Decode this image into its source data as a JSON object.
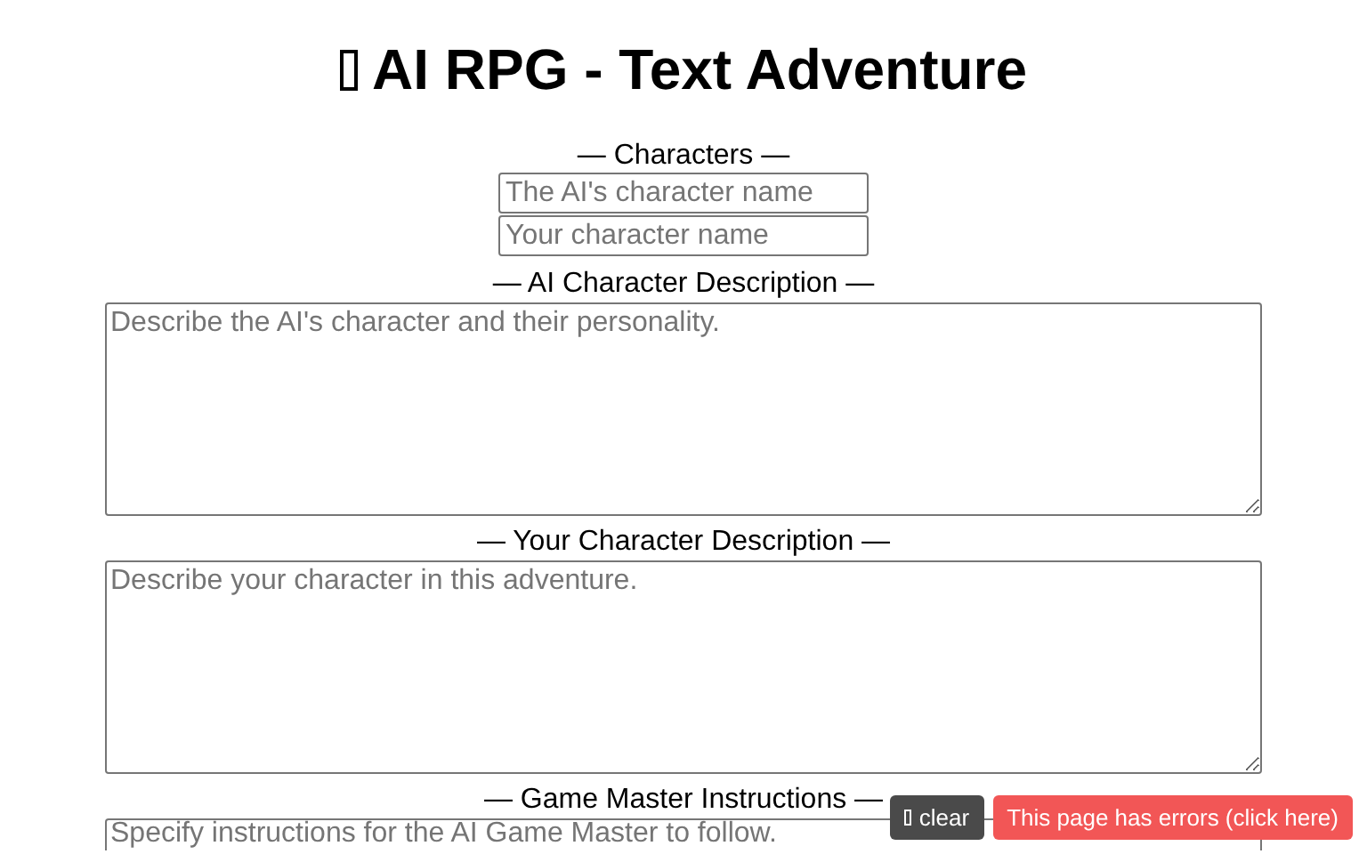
{
  "title": "AI RPG - Text Adventure",
  "sections": [
    {
      "label": "— Characters —",
      "kind": "inputs",
      "fields": [
        {
          "placeholder": "The AI's character name"
        },
        {
          "placeholder": "Your character name"
        }
      ]
    },
    {
      "label": "— AI Character Description —",
      "kind": "textarea",
      "placeholder": "Describe the AI's character and their personality."
    },
    {
      "label": "— Your Character Description —",
      "kind": "textarea",
      "placeholder": "Describe your character in this adventure."
    },
    {
      "label": "— Game Master Instructions —",
      "kind": "textarea",
      "placeholder": "Specify instructions for the AI Game Master to follow."
    }
  ],
  "overlay": {
    "clear_button": "clear",
    "error_button": "This page has errors (click here)"
  }
}
